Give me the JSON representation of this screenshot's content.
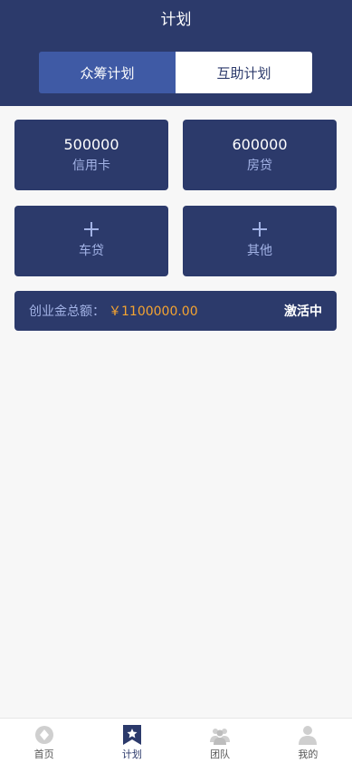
{
  "header": {
    "title": "计划"
  },
  "tabs": [
    {
      "label": "众筹计划",
      "active": true
    },
    {
      "label": "互助计划",
      "active": false
    }
  ],
  "cards": [
    {
      "amount": "500000",
      "label": "信用卡"
    },
    {
      "amount": "600000",
      "label": "房贷"
    },
    {
      "amount": "",
      "label": "车贷",
      "icon": "plus-icon"
    },
    {
      "amount": "",
      "label": "其他",
      "icon": "plus-icon"
    }
  ],
  "total": {
    "label": "创业金总额：",
    "value": "￥1100000.00",
    "status": "激活中"
  },
  "tabbar": [
    {
      "label": "首页",
      "icon": "home-icon",
      "active": false
    },
    {
      "label": "计划",
      "icon": "star-bookmark-icon",
      "active": true
    },
    {
      "label": "团队",
      "icon": "team-icon",
      "active": false
    },
    {
      "label": "我的",
      "icon": "user-icon",
      "active": false
    }
  ],
  "colors": {
    "primary": "#2c3a6b",
    "tab_active": "#3f5aa5",
    "accent": "#f5a431",
    "label": "#a3b3e6"
  }
}
